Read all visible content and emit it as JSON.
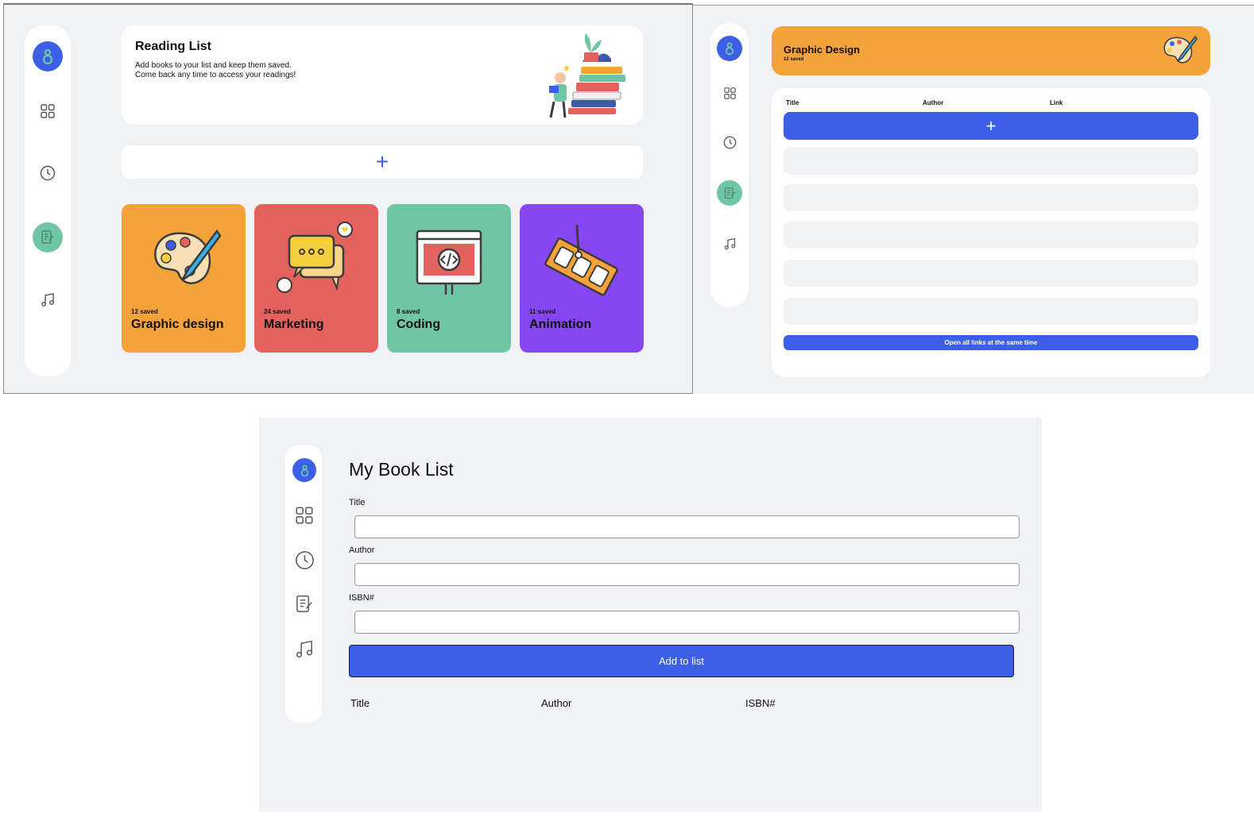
{
  "colors": {
    "accent_blue": "#3d5fe6",
    "orange": "#f4a23a",
    "coral": "#e4625e",
    "green": "#6fc6a5",
    "purple": "#8547f1",
    "bg": "#f1f2f5"
  },
  "nav_icons": [
    "logo-icon",
    "grid-icon",
    "clock-icon",
    "notes-icon",
    "music-icon"
  ],
  "reading_list": {
    "title": "Reading List",
    "desc_line1": "Add books to your list and keep them saved.",
    "desc_line2": "Come back any time to access your readings!",
    "add_symbol": "+",
    "categories": [
      {
        "count": "12 saved",
        "name": "Graphic design",
        "color": "#f4a23a",
        "icon": "palette-icon"
      },
      {
        "count": "24 saved",
        "name": "Marketing",
        "color": "#e4625e",
        "icon": "chat-bubbles-icon"
      },
      {
        "count": "8 saved",
        "name": "Coding",
        "color": "#6fc6a5",
        "icon": "code-window-icon"
      },
      {
        "count": "11 saved",
        "name": "Animation",
        "color": "#8547f1",
        "icon": "film-strip-icon"
      }
    ]
  },
  "category_detail": {
    "title": "Graphic Design",
    "count": "12 saved",
    "columns": [
      "Title",
      "Author",
      "Link"
    ],
    "add_symbol": "+",
    "open_all_label": "Open all links at the same time"
  },
  "book_form": {
    "title": "My Book List",
    "title_label": "Title",
    "author_label": "Author",
    "isbn_label": "ISBN#",
    "submit_label": "Add to list",
    "columns": [
      "Title",
      "Author",
      "ISBN#"
    ]
  }
}
